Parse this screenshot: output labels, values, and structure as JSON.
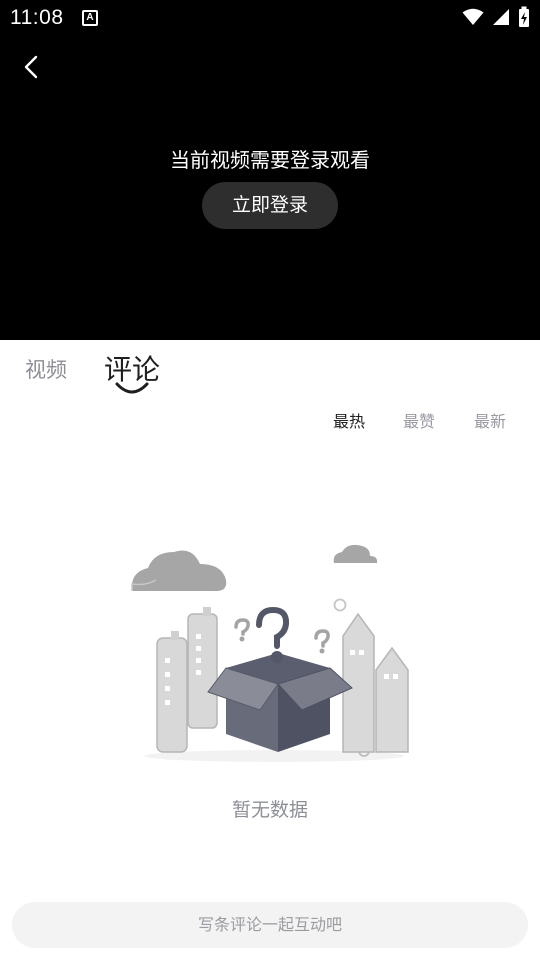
{
  "status_bar": {
    "time": "11:08",
    "notification_icon_letter": "A",
    "icons": [
      "wifi-icon",
      "signal-icon",
      "battery-charging-icon"
    ]
  },
  "player": {
    "login_message": "当前视频需要登录观看",
    "login_button": "立即登录"
  },
  "tabs": [
    {
      "label": "视频",
      "active": false
    },
    {
      "label": "评论",
      "active": true
    }
  ],
  "sort": [
    {
      "label": "最热",
      "active": true
    },
    {
      "label": "最赞",
      "active": false
    },
    {
      "label": "最新",
      "active": false
    }
  ],
  "empty_state": {
    "text": "暂无数据"
  },
  "comment_input": {
    "placeholder": "写条评论一起互动吧"
  },
  "colors": {
    "player_bg": "#000000",
    "button_bg": "#2e2e2e",
    "inactive_text": "#8e8e96",
    "active_text": "#1f1f1f",
    "input_bg": "#f3f3f3"
  }
}
